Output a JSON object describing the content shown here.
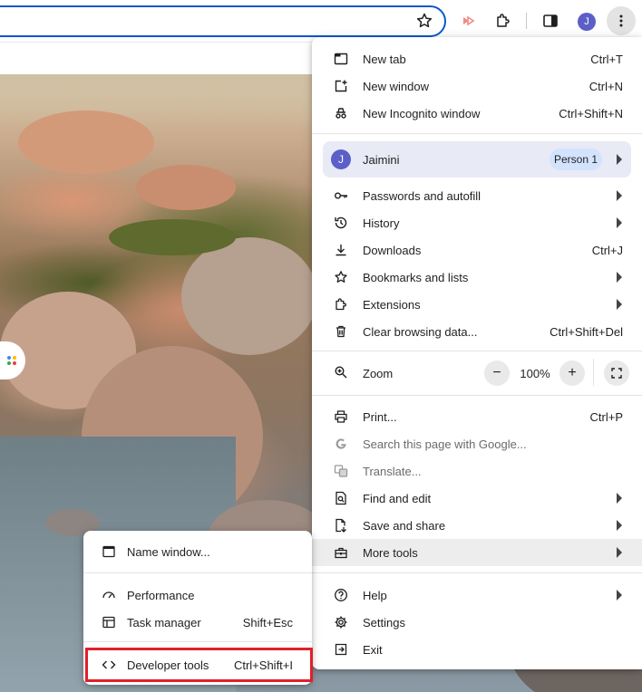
{
  "toolbar": {
    "profile_initial": "J"
  },
  "ntp": {},
  "menu": {
    "items_top": [
      {
        "label": "New tab",
        "shortcut": "Ctrl+T",
        "icon": "new-tab-icon"
      },
      {
        "label": "New window",
        "shortcut": "Ctrl+N",
        "icon": "new-window-icon"
      },
      {
        "label": "New Incognito window",
        "shortcut": "Ctrl+Shift+N",
        "icon": "incognito-icon"
      }
    ],
    "profile": {
      "initial": "J",
      "name": "Jaimini",
      "badge": "Person 1"
    },
    "items_mid": [
      {
        "label": "Passwords and autofill",
        "shortcut": "",
        "icon": "key-icon"
      },
      {
        "label": "History",
        "shortcut": "",
        "icon": "history-icon"
      },
      {
        "label": "Downloads",
        "shortcut": "Ctrl+J",
        "icon": "download-icon"
      },
      {
        "label": "Bookmarks and lists",
        "shortcut": "",
        "icon": "star-icon"
      },
      {
        "label": "Extensions",
        "shortcut": "",
        "icon": "puzzle-icon"
      },
      {
        "label": "Clear browsing data...",
        "shortcut": "Ctrl+Shift+Del",
        "icon": "trash-icon"
      }
    ],
    "zoom": {
      "label": "Zoom",
      "minus": "−",
      "value": "100%",
      "plus": "+"
    },
    "items_tools": [
      {
        "label": "Print...",
        "shortcut": "Ctrl+P",
        "icon": "print-icon"
      },
      {
        "label": "Search this page with Google...",
        "shortcut": "",
        "icon": "google-icon"
      },
      {
        "label": "Translate...",
        "shortcut": "",
        "icon": "translate-icon"
      },
      {
        "label": "Find and edit",
        "shortcut": "",
        "icon": "find-icon"
      },
      {
        "label": "Save and share",
        "shortcut": "",
        "icon": "save-icon"
      },
      {
        "label": "More tools",
        "shortcut": "",
        "icon": "toolbox-icon"
      }
    ],
    "items_bottom": [
      {
        "label": "Help",
        "shortcut": "",
        "icon": "help-icon"
      },
      {
        "label": "Settings",
        "shortcut": "",
        "icon": "gear-icon"
      },
      {
        "label": "Exit",
        "shortcut": "",
        "icon": "exit-icon"
      }
    ]
  },
  "submenu": {
    "items": [
      {
        "label": "Name window...",
        "shortcut": "",
        "icon": "window-icon"
      },
      {
        "label": "Performance",
        "shortcut": "",
        "icon": "gauge-icon"
      },
      {
        "label": "Task manager",
        "shortcut": "Shift+Esc",
        "icon": "task-manager-icon"
      },
      {
        "label": "Developer tools",
        "shortcut": "Ctrl+Shift+I",
        "icon": "code-icon"
      }
    ]
  },
  "colors": {
    "accent": "#0b57d0",
    "profile_bg": "#e8eaf6",
    "badge_bg": "#d3e3fd",
    "avatar": "#5b5fc7",
    "highlight_outline": "#e0202a"
  }
}
